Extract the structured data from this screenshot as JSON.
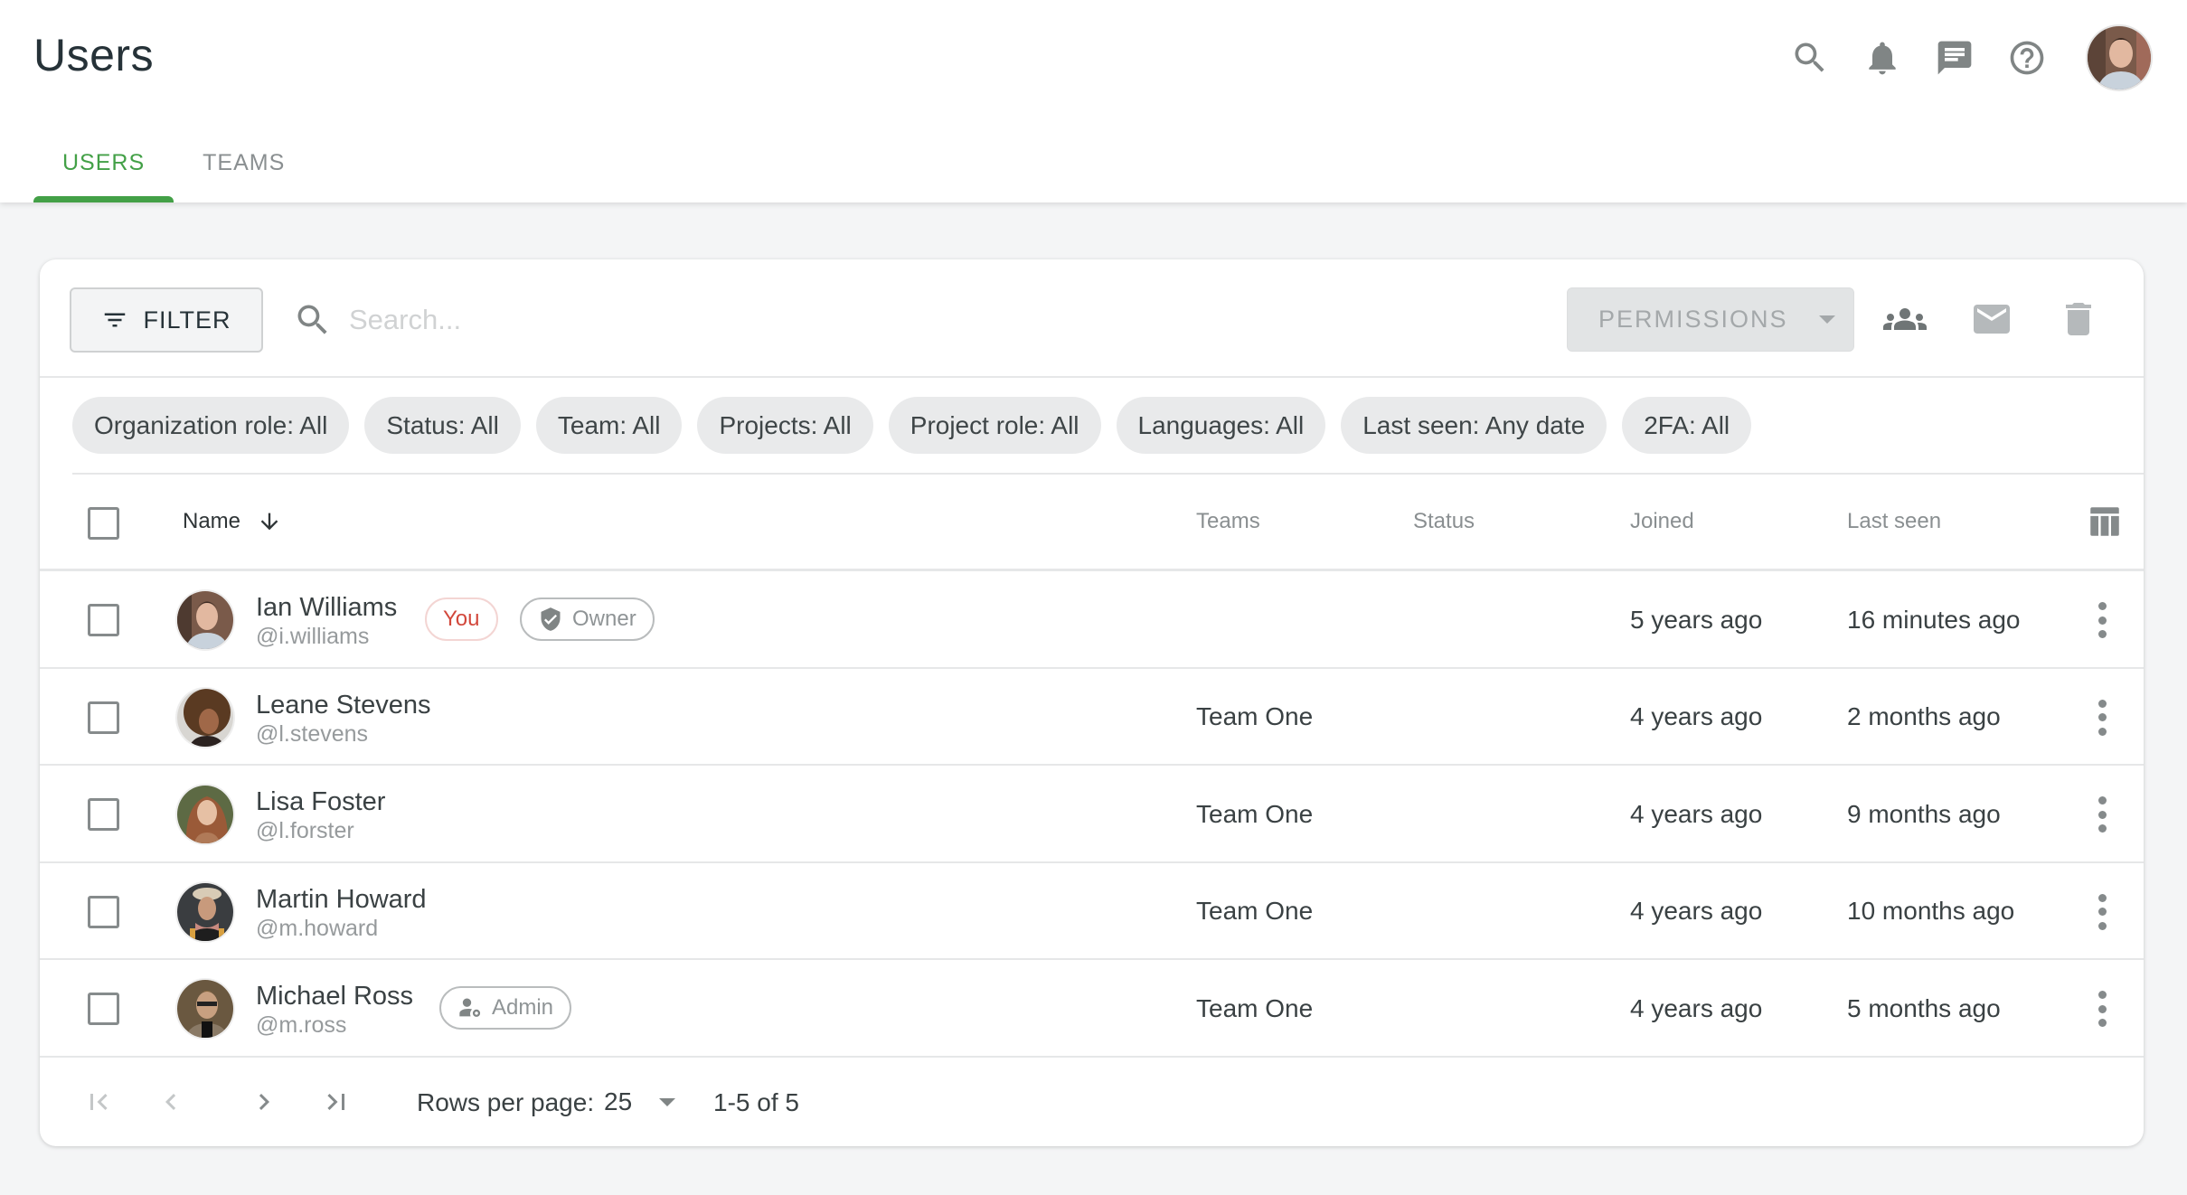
{
  "header": {
    "title": "Users",
    "icons": [
      "search-icon",
      "notifications-bell-icon",
      "chat-message-icon",
      "help-question-icon"
    ],
    "avatar_alt": "Current user avatar"
  },
  "tabs": [
    {
      "label": "USERS",
      "active": true
    },
    {
      "label": "TEAMS",
      "active": false
    }
  ],
  "toolbar": {
    "filter_label": "FILTER",
    "search_placeholder": "Search...",
    "search_value": "",
    "permissions_label": "PERMISSIONS",
    "actions": [
      "assign-team-icon",
      "email-icon",
      "delete-icon"
    ]
  },
  "filters": [
    "Organization role: All",
    "Status: All",
    "Team: All",
    "Projects: All",
    "Project role: All",
    "Languages: All",
    "Last seen: Any date",
    "2FA: All"
  ],
  "table": {
    "columns": {
      "name": "Name",
      "teams": "Teams",
      "status": "Status",
      "joined": "Joined",
      "last_seen": "Last seen"
    },
    "sort": {
      "column": "Name",
      "direction": "descending"
    },
    "rows": [
      {
        "name": "Ian Williams",
        "handle": "@i.williams",
        "you_badge": "You",
        "role_badge": "Owner",
        "role_icon": "shield-check-icon",
        "teams": "",
        "status": "",
        "joined": "5 years ago",
        "last_seen": "16 minutes ago"
      },
      {
        "name": "Leane Stevens",
        "handle": "@l.stevens",
        "you_badge": "",
        "role_badge": "",
        "teams": "Team One",
        "status": "",
        "joined": "4 years ago",
        "last_seen": "2 months ago"
      },
      {
        "name": "Lisa Foster",
        "handle": "@l.forster",
        "you_badge": "",
        "role_badge": "",
        "teams": "Team One",
        "status": "",
        "joined": "4 years ago",
        "last_seen": "9 months ago"
      },
      {
        "name": "Martin Howard",
        "handle": "@m.howard",
        "you_badge": "",
        "role_badge": "",
        "teams": "Team One",
        "status": "",
        "joined": "4 years ago",
        "last_seen": "10 months ago"
      },
      {
        "name": "Michael Ross",
        "handle": "@m.ross",
        "you_badge": "",
        "role_badge": "Admin",
        "role_icon": "user-gear-icon",
        "teams": "Team One",
        "status": "",
        "joined": "4 years ago",
        "last_seen": "5 months ago"
      }
    ]
  },
  "pagination": {
    "rows_per_page_label": "Rows per page:",
    "rows_per_page": "25",
    "range": "1-5 of 5"
  },
  "colors": {
    "accent": "#43a047",
    "you_badge": "#d2473b",
    "icon_gray": "#808585"
  }
}
